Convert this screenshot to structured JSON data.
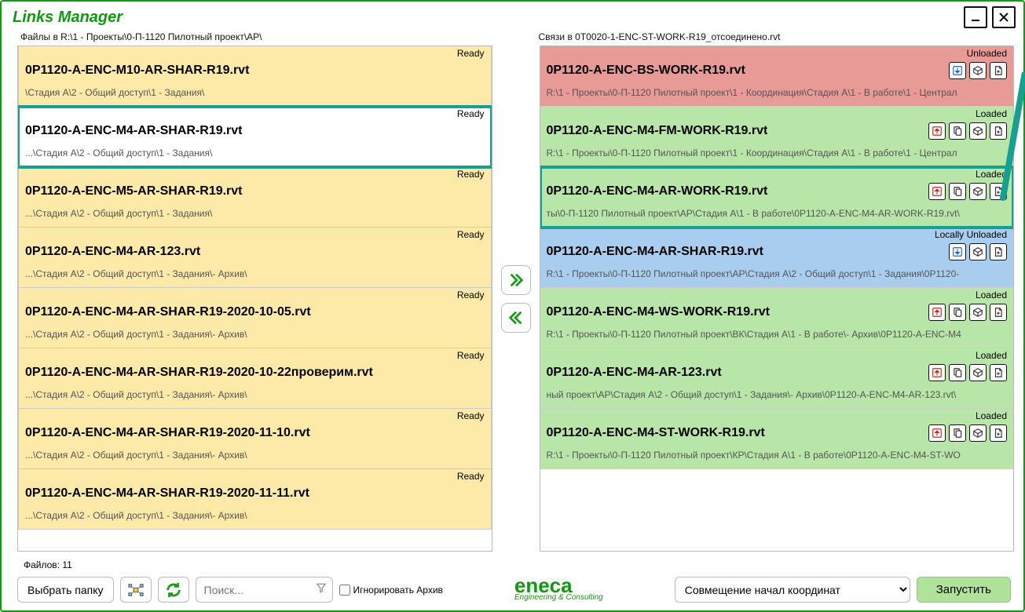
{
  "title": "Links Manager",
  "filesHeader": "Файлы в  R:\\1 - Проекты\\0-П-1120 Пилотный проект\\АР\\",
  "linksHeader": "Связи в  0T0020-1-ENC-ST-WORK-R19_отсоединено.rvt",
  "files": [
    {
      "status": "Ready",
      "name": "0P1120-A-ENC-M10-AR-SHAR-R19.rvt",
      "path": "\\Стадия А\\2 - Общий доступ\\1 - Задания\\",
      "selected": false
    },
    {
      "status": "Ready",
      "name": "0P1120-A-ENC-M4-AR-SHAR-R19.rvt",
      "path": "...\\Стадия А\\2 - Общий доступ\\1 - Задания\\",
      "selected": true
    },
    {
      "status": "Ready",
      "name": "0P1120-A-ENC-M5-AR-SHAR-R19.rvt",
      "path": "...\\Стадия А\\2 - Общий доступ\\1 - Задания\\",
      "selected": false
    },
    {
      "status": "Ready",
      "name": "0P1120-A-ENC-M4-AR-123.rvt",
      "path": "...\\Стадия А\\2 - Общий доступ\\1 - Задания\\- Архив\\",
      "selected": false
    },
    {
      "status": "Ready",
      "name": "0P1120-A-ENC-M4-AR-SHAR-R19-2020-10-05.rvt",
      "path": "...\\Стадия А\\2 - Общий доступ\\1 - Задания\\- Архив\\",
      "selected": false
    },
    {
      "status": "Ready",
      "name": "0P1120-A-ENC-M4-AR-SHAR-R19-2020-10-22проверим.rvt",
      "path": "...\\Стадия А\\2 - Общий доступ\\1 - Задания\\- Архив\\",
      "selected": false
    },
    {
      "status": "Ready",
      "name": "0P1120-A-ENC-M4-AR-SHAR-R19-2020-11-10.rvt",
      "path": "...\\Стадия А\\2 - Общий доступ\\1 - Задания\\- Архив\\",
      "selected": false
    },
    {
      "status": "Ready",
      "name": "0P1120-A-ENC-M4-AR-SHAR-R19-2020-11-11.rvt",
      "path": "...\\Стадия А\\2 - Общий доступ\\1 - Задания\\- Архив\\",
      "selected": false
    }
  ],
  "links": [
    {
      "status": "Unloaded",
      "kind": "unloaded",
      "name": "0P1120-A-ENC-BS-WORK-R19.rvt",
      "path": "R:\\1 - Проекты\\0-П-1120 Пилотный проект\\1 - Координация\\Стадия А\\1 - В работе\\1 - Централ",
      "icons": [
        "down",
        "cube",
        "page"
      ],
      "selected": false
    },
    {
      "status": "Loaded",
      "kind": "loaded",
      "name": "0P1120-A-ENC-M4-FM-WORK-R19.rvt",
      "path": "R:\\1 - Проекты\\0-П-1120 Пилотный проект\\1 - Координация\\Стадия А\\1 - В работе\\1 - Централ",
      "icons": [
        "up",
        "copy",
        "cube",
        "page"
      ],
      "selected": false
    },
    {
      "status": "Loaded",
      "kind": "loaded",
      "name": "0P1120-A-ENC-M4-AR-WORK-R19.rvt",
      "path": "ты\\0-П-1120 Пилотный проект\\АР\\Стадия А\\1 - В работе\\0P1120-A-ENC-M4-AR-WORK-R19.rvt\\",
      "icons": [
        "up",
        "copy",
        "cube",
        "page"
      ],
      "selected": true
    },
    {
      "status": "Locally Unloaded",
      "kind": "locally",
      "name": "0P1120-A-ENC-M4-AR-SHAR-R19.rvt",
      "path": "R:\\1 - Проекты\\0-П-1120 Пилотный проект\\АР\\Стадия А\\2 - Общий доступ\\1 - Задания\\0P1120-",
      "icons": [
        "down",
        "cube",
        "page"
      ],
      "selected": false
    },
    {
      "status": "Loaded",
      "kind": "loaded",
      "name": "0P1120-A-ENC-M4-WS-WORK-R19.rvt",
      "path": "R:\\1 - Проекты\\0-П-1120 Пилотный проект\\ВК\\Стадия А\\1 - В работе\\- Архив\\0P1120-A-ENC-M4",
      "icons": [
        "up",
        "copy",
        "cube",
        "page"
      ],
      "selected": false
    },
    {
      "status": "Loaded",
      "kind": "loaded",
      "name": "0P1120-A-ENC-M4-AR-123.rvt",
      "path": "ный проект\\АР\\Стадия А\\2 - Общий доступ\\1 - Задания\\- Архив\\0P1120-A-ENC-M4-AR-123.rvt\\",
      "icons": [
        "up",
        "copy",
        "cube",
        "page"
      ],
      "selected": false
    },
    {
      "status": "Loaded",
      "kind": "loaded",
      "name": "0P1120-A-ENC-M4-ST-WORK-R19.rvt",
      "path": "R:\\1 - Проекты\\0-П-1120 Пилотный проект\\КР\\Стадия А\\1 - В работе\\0P1120-A-ENC-M4-ST-WO",
      "icons": [
        "up",
        "copy",
        "cube",
        "page"
      ],
      "selected": false
    }
  ],
  "fileCount": "Файлов: 11",
  "chooseFolder": "Выбрать папку",
  "searchPlaceholder": "Поиск...",
  "ignoreArchive": "Игнорировать Архив",
  "brandName": "eneca",
  "brandTag": "Engineering & Consulting",
  "positioning": "Совмещение начал координат",
  "run": "Запустить"
}
